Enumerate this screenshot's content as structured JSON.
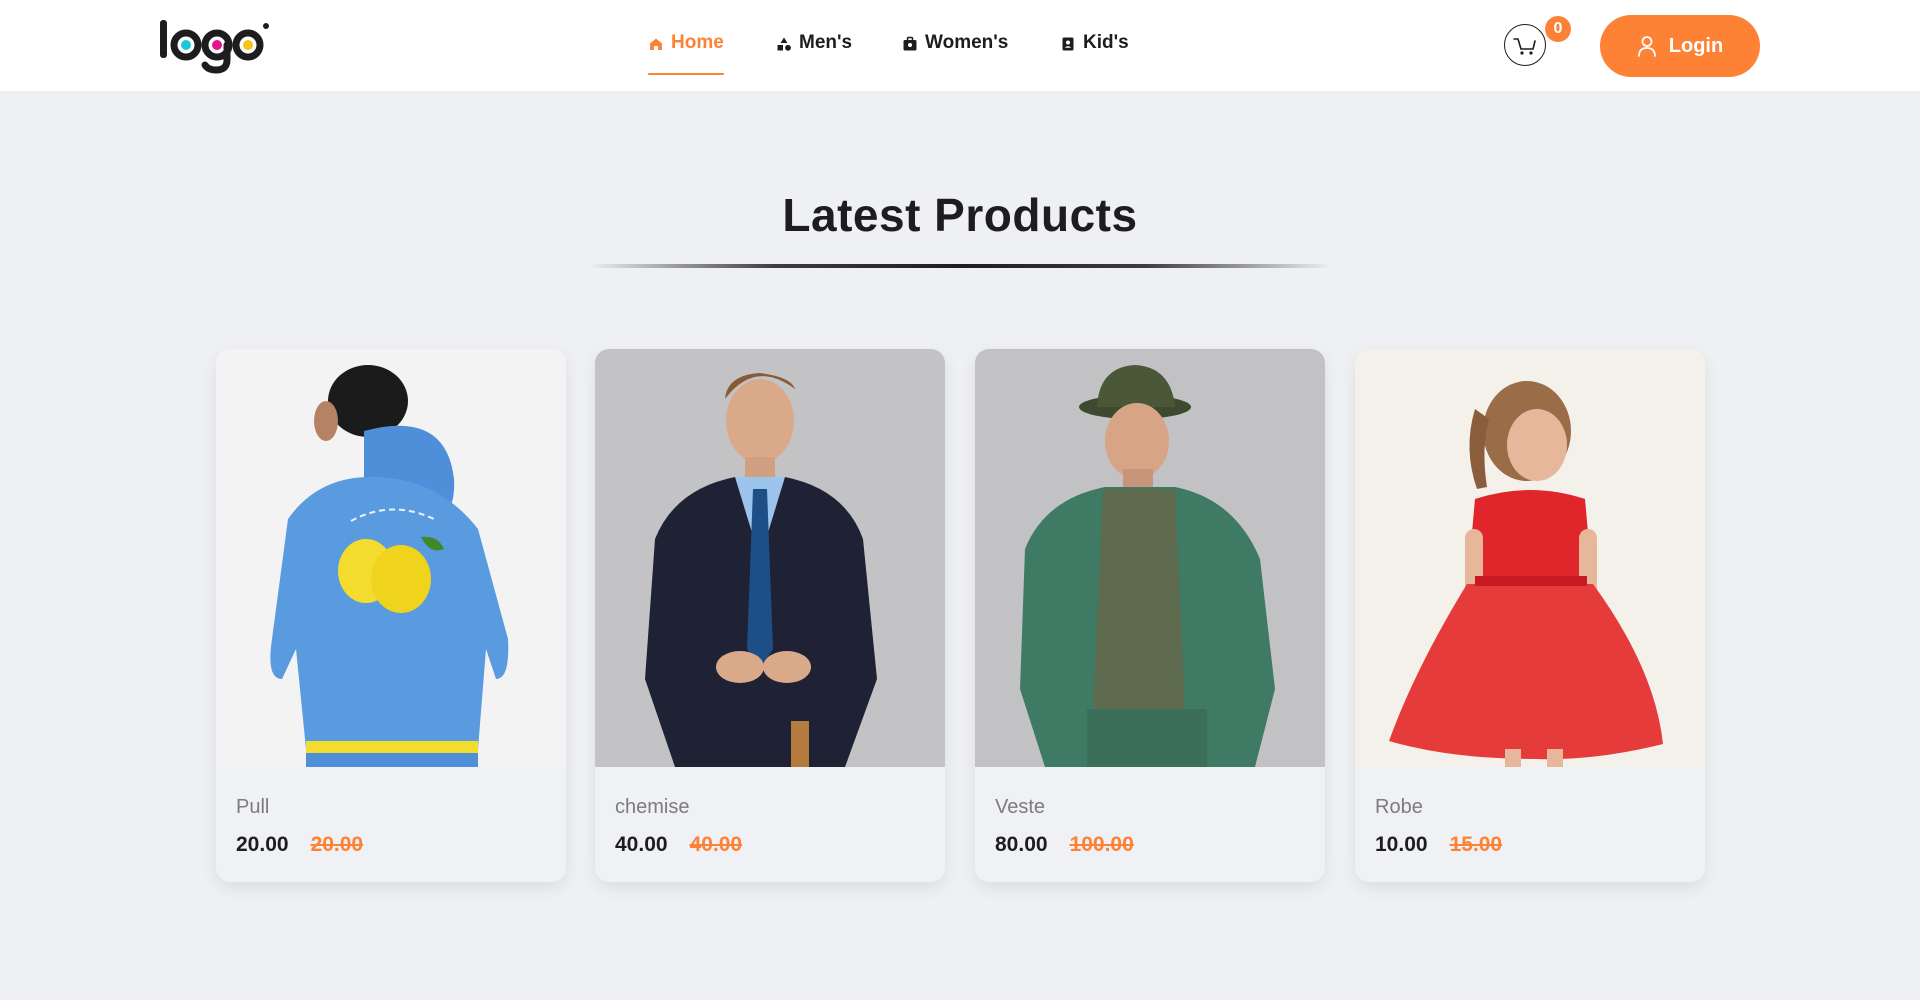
{
  "header": {
    "logo_text": "logo",
    "nav": [
      {
        "label": "Home",
        "icon": "home-icon",
        "active": true
      },
      {
        "label": "Men's",
        "icon": "shapes-icon",
        "active": false
      },
      {
        "label": "Women's",
        "icon": "bag-icon",
        "active": false
      },
      {
        "label": "Kid's",
        "icon": "contact-card-icon",
        "active": false
      }
    ],
    "cart": {
      "icon": "cart-icon",
      "count": "0"
    },
    "login_label": "Login",
    "login_icon": "user-icon"
  },
  "main": {
    "title": "Latest Products",
    "products": [
      {
        "name": "Pull",
        "price": "20.00",
        "old_price": "20.00",
        "image": "boy-in-blue-lemon-hoodie"
      },
      {
        "name": "chemise",
        "price": "40.00",
        "old_price": "40.00",
        "image": "man-in-navy-suit"
      },
      {
        "name": "Veste",
        "price": "80.00",
        "old_price": "100.00",
        "image": "man-in-green-denim-jacket"
      },
      {
        "name": "Robe",
        "price": "10.00",
        "old_price": "15.00",
        "image": "girl-in-red-dress"
      }
    ]
  },
  "colors": {
    "accent": "#fd8236",
    "page_bg": "#eff0f3",
    "card_bg": "#f0f1f4",
    "text": "#1d1d1f",
    "muted": "#7b7b80"
  }
}
